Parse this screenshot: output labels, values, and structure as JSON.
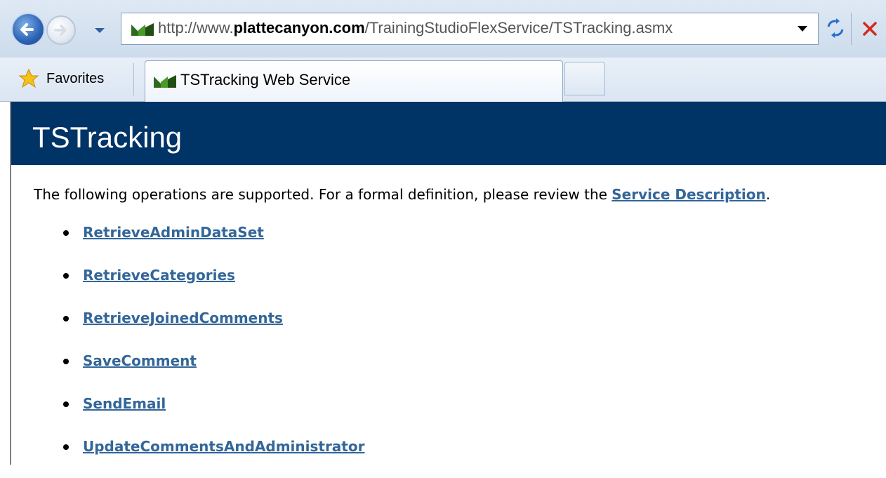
{
  "browser": {
    "url_prefix": "http://www.",
    "url_domain": "plattecanyon.com",
    "url_path": "/TrainingStudioFlexService/TSTracking.asmx",
    "favorites_label": "Favorites",
    "active_tab_label": "TSTracking Web Service"
  },
  "page": {
    "title": "TSTracking",
    "intro_text": "The following operations are supported. For a formal definition, please review the ",
    "intro_link": "Service Description",
    "intro_end": ".",
    "operations": [
      "RetrieveAdminDataSet",
      "RetrieveCategories",
      "RetrieveJoinedComments",
      "SaveComment",
      "SendEmail",
      "UpdateCommentsAndAdministrator"
    ]
  },
  "colors": {
    "banner": "#003366",
    "link": "#336699"
  },
  "icons": [
    "back-arrow-icon",
    "forward-arrow-icon",
    "site-favicon-icon",
    "refresh-icon",
    "stop-icon",
    "favorites-star-icon"
  ]
}
